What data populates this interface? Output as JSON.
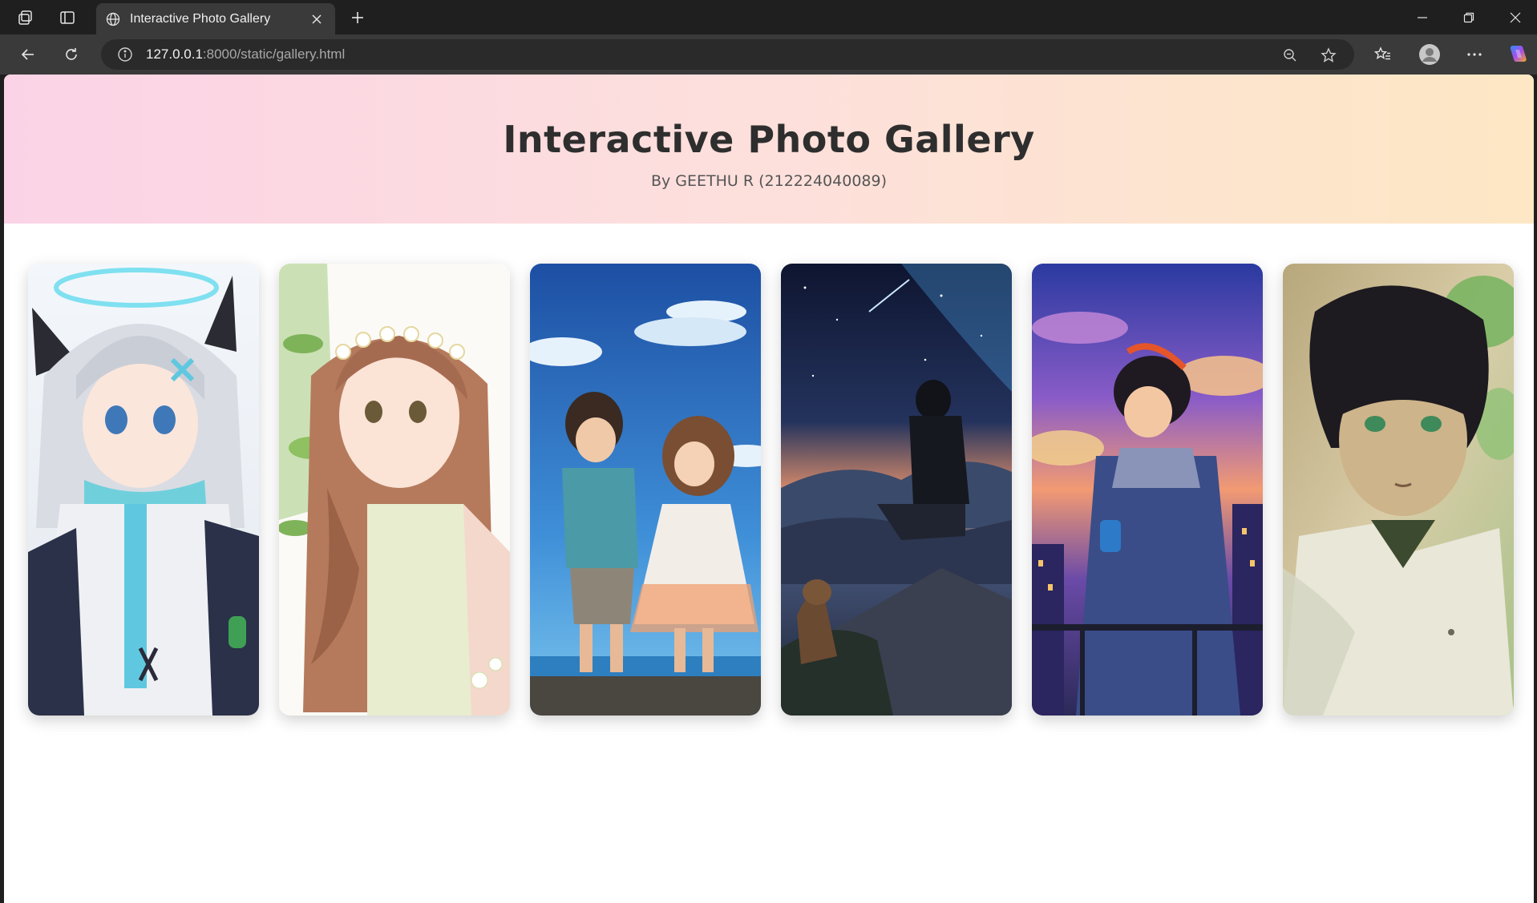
{
  "browser": {
    "tab_title": "Interactive Photo Gallery",
    "url_host": "127.0.0.1",
    "url_rest": ":8000/static/gallery.html",
    "icons": [
      "workspaces-icon",
      "vertical-tabs-icon",
      "globe-icon",
      "close-icon",
      "new-tab-icon",
      "minimize-icon",
      "restore-icon",
      "window-close-icon",
      "back-icon",
      "refresh-icon",
      "site-info-icon",
      "zoom-out-icon",
      "favorite-star-icon",
      "favorites-icon",
      "profile-icon",
      "more-icon",
      "copilot-icon"
    ]
  },
  "page": {
    "title": "Interactive Photo Gallery",
    "subtitle": "By GEETHU R (212224040089)"
  },
  "gallery": {
    "photos": [
      {
        "subject": "silver-haired girl with cat ears and teal scarf"
      },
      {
        "subject": "girl with flower crown and braided hair"
      },
      {
        "subject": "couple walking by the sea under blue sky"
      },
      {
        "subject": "boy and dog on a hill under night sky"
      },
      {
        "subject": "boy in hoodie with drink at sunset"
      },
      {
        "subject": "dark-haired boy with green eyes in dappled light"
      }
    ]
  },
  "colors": {
    "hero_gradient_start": "#fbd3e6",
    "hero_gradient_mid": "#fde0dc",
    "hero_gradient_end": "#fde7c4",
    "title_color": "#2e2e2e"
  }
}
